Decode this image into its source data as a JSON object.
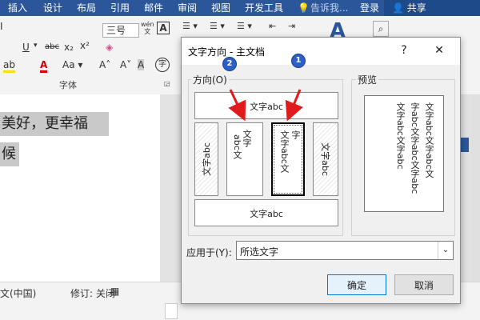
{
  "ribbon": {
    "tabs": [
      "插入",
      "设计",
      "布局",
      "引用",
      "邮件",
      "审阅",
      "视图",
      "开发工具"
    ],
    "tell_me": "告诉我...",
    "login": "登录",
    "share": "共享",
    "font_size": "三号",
    "font_group_label": "字体",
    "wen": "wén",
    "wen_char": "文"
  },
  "document": {
    "line1": "美好，更幸福",
    "line2": "候"
  },
  "status": {
    "language": "文(中国)",
    "track_changes": "修订: 关闭"
  },
  "dialog": {
    "title": "文字方向 - 主文档",
    "help": "?",
    "close": "✕",
    "direction_label": "方向(O)",
    "preview_label": "预览",
    "option_horizontal": "文字abc",
    "option_vert_rotate": "文字abc",
    "option_stack_a": "文字",
    "option_stack_a_rest": "abc文",
    "option_stack_b": "字",
    "option_stack_b_rest": "文字abc文",
    "option_rot_left": "文字abc",
    "option_flipped": "文字abc",
    "preview_lines": [
      "文字abc文字abc文",
      "字abc文字abc文字abc",
      "文字abc文字abc"
    ],
    "apply_label": "应用于(Y):",
    "apply_value": "所选文字",
    "ok": "确定",
    "cancel": "取消",
    "badge1": "1",
    "badge2": "2"
  },
  "colors": {
    "accent": "#2b579a",
    "arrow": "#e01b1b",
    "badge": "#2c5fc7"
  }
}
